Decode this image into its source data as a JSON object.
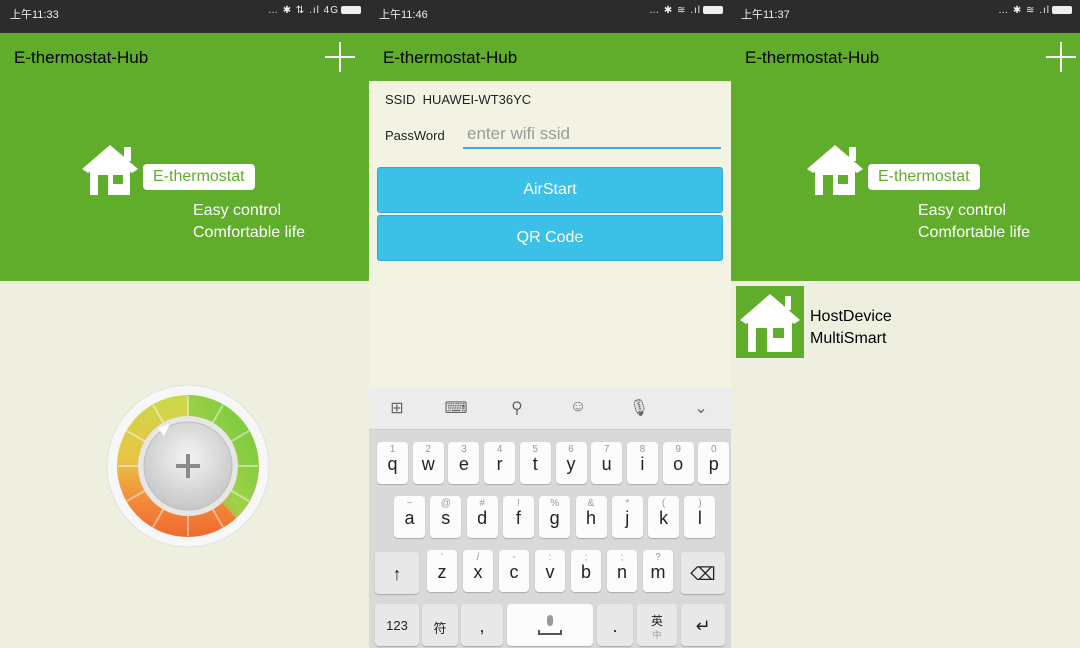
{
  "screens": [
    {
      "status": {
        "time": "上午11:33",
        "icons": "… ✱ ⇅ .ıl 4G"
      },
      "app_title": "E-thermostat-Hub",
      "banner": {
        "brand": "E-thermostat",
        "slogan_line1": "Easy control",
        "slogan_line2": "Comfortable life"
      },
      "dial_icon": "plus-icon"
    },
    {
      "status": {
        "time": "上午11:46",
        "icons": "… ✱ ≋ .ıl"
      },
      "app_title": "E-thermostat-Hub",
      "ssid_label": "SSID",
      "ssid_value": "HUAWEI-WT36YC",
      "password_label": "PassWord",
      "password_placeholder": "enter wifi ssid",
      "airstart_label": "AirStart",
      "qrcode_label": "QR Code",
      "keyboard": {
        "toolbar": [
          "⊞",
          "⌨",
          "⚲",
          "☺",
          "🎙",
          "⌄"
        ],
        "row1": [
          {
            "sub": "1",
            "k": "q"
          },
          {
            "sub": "2",
            "k": "w"
          },
          {
            "sub": "3",
            "k": "e"
          },
          {
            "sub": "4",
            "k": "r"
          },
          {
            "sub": "5",
            "k": "t"
          },
          {
            "sub": "6",
            "k": "y"
          },
          {
            "sub": "7",
            "k": "u"
          },
          {
            "sub": "8",
            "k": "i"
          },
          {
            "sub": "9",
            "k": "o"
          },
          {
            "sub": "0",
            "k": "p"
          }
        ],
        "row2": [
          {
            "sub": "~",
            "k": "a"
          },
          {
            "sub": "@",
            "k": "s"
          },
          {
            "sub": "#",
            "k": "d"
          },
          {
            "sub": "!",
            "k": "f"
          },
          {
            "sub": "%",
            "k": "g"
          },
          {
            "sub": "&",
            "k": "h"
          },
          {
            "sub": "*",
            "k": "j"
          },
          {
            "sub": "(",
            "k": "k"
          },
          {
            "sub": ")",
            "k": "l"
          }
        ],
        "row3": [
          {
            "sub": "'",
            "k": "z"
          },
          {
            "sub": "/",
            "k": "x"
          },
          {
            "sub": "-",
            "k": "c"
          },
          {
            "sub": ":",
            "k": "v"
          },
          {
            "sub": ";",
            "k": "b"
          },
          {
            "sub": ";",
            "k": "n"
          },
          {
            "sub": "?",
            "k": "m"
          }
        ],
        "shift": "↑",
        "backspace": "⌫",
        "num_key": "123",
        "sym_key": "符",
        "comma_key": ",",
        "period_key": ".",
        "lang_key": "英",
        "lang_sub": "中",
        "enter_key": "↵"
      }
    },
    {
      "status": {
        "time": "上午11:37",
        "icons": "… ✱ ≋ .ıl"
      },
      "app_title": "E-thermostat-Hub",
      "banner": {
        "brand": "E-thermostat",
        "slogan_line1": "Easy control",
        "slogan_line2": "Comfortable life"
      },
      "devices": [
        {
          "line1": "HostDevice",
          "line2": "MultiSmart"
        }
      ]
    }
  ],
  "colors": {
    "accent": "#5fad2a",
    "button": "#3bc0e8",
    "background": "#efefdf",
    "statusbar": "#2c2c2c"
  }
}
